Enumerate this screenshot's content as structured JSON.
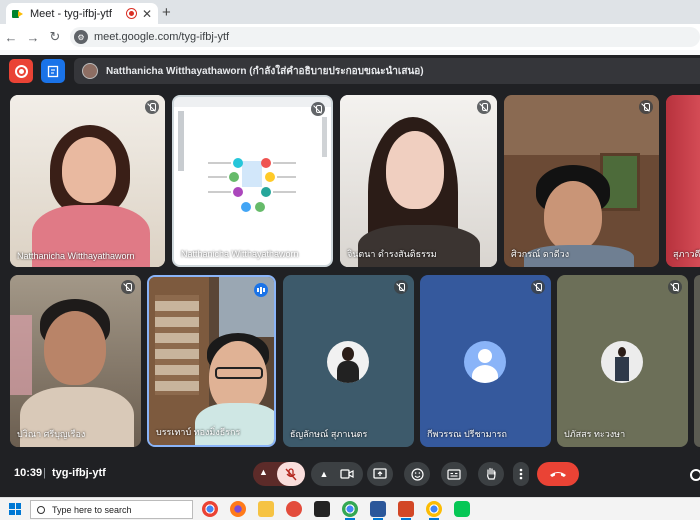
{
  "browser": {
    "tab_title": "Meet - tyg-ifbj-ytf",
    "new_tab": "+",
    "close_tab": "✕",
    "url": "meet.google.com/tyg-ifbj-ytf"
  },
  "meet": {
    "presenter_text": "Natthanicha Witthayathaworn (กำลังใส่คำอธิบายประกอบขณะนำเสนอ)",
    "participants": [
      {
        "name": "Natthanicha Witthayathaworn"
      },
      {
        "name": "Natthanicha Witthayathaworn"
      },
      {
        "name": "จินตนา ดำรงสันติธรรม"
      },
      {
        "name": "ศิวกรณ์ ดาดีวง"
      },
      {
        "name": "สุภาวดี"
      },
      {
        "name": "ปวิณา ศรีบุญเรือง"
      },
      {
        "name": "บรรเทาบ์ ทองมิ่งธีรกร"
      },
      {
        "name": "ธัญลักษณ์ สุภาเนตร"
      },
      {
        "name": "กีพวรรณ ปรีชามารถ"
      },
      {
        "name": "ปภัสสร ทะวงษา"
      }
    ],
    "time": "10:39",
    "separator": "|",
    "meeting_code": "tyg-ifbj-ytf"
  },
  "taskbar": {
    "search_placeholder": "Type here to search"
  },
  "colors": {
    "end_call": "#ea4335",
    "record": "#ea4335",
    "notes": "#1a73e8",
    "background": "#202124"
  }
}
